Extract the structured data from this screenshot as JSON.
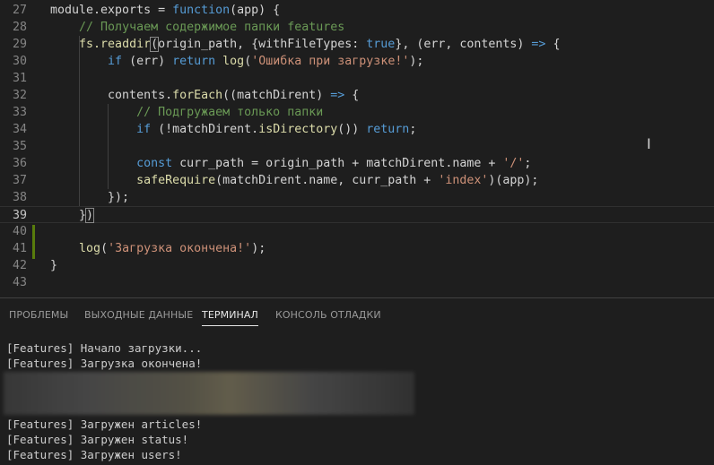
{
  "editor": {
    "lines": [
      {
        "num": "27",
        "tokens": [
          [
            "pl",
            "module.exports = "
          ],
          [
            "kw",
            "function"
          ],
          [
            "pl",
            "(app) {"
          ]
        ]
      },
      {
        "num": "28",
        "tokens": [
          [
            "pl",
            "    "
          ],
          [
            "cmt",
            "// Получаем содержимое папки features"
          ]
        ]
      },
      {
        "num": "29",
        "tokens": [
          [
            "pl",
            "    "
          ],
          [
            "fn",
            "fs.readdir"
          ],
          [
            "br",
            "("
          ],
          [
            "pl",
            "origin_path, {withFileTypes: "
          ],
          [
            "kw",
            "true"
          ],
          [
            "pl",
            "}, (err, contents) "
          ],
          [
            "kw",
            "=>"
          ],
          [
            "pl",
            " {"
          ]
        ]
      },
      {
        "num": "30",
        "tokens": [
          [
            "pl",
            "        "
          ],
          [
            "kw",
            "if"
          ],
          [
            "pl",
            " (err) "
          ],
          [
            "kw",
            "return"
          ],
          [
            "pl",
            " "
          ],
          [
            "fn",
            "log"
          ],
          [
            "pl",
            "("
          ],
          [
            "str",
            "'Ошибка при загрузке!'"
          ],
          [
            "pl",
            ");"
          ]
        ]
      },
      {
        "num": "31",
        "tokens": []
      },
      {
        "num": "32",
        "tokens": [
          [
            "pl",
            "        contents."
          ],
          [
            "fn",
            "forEach"
          ],
          [
            "pl",
            "((matchDirent) "
          ],
          [
            "kw",
            "=>"
          ],
          [
            "pl",
            " {"
          ]
        ]
      },
      {
        "num": "33",
        "tokens": [
          [
            "pl",
            "            "
          ],
          [
            "cmt",
            "// Подгружаем только папки"
          ]
        ]
      },
      {
        "num": "34",
        "tokens": [
          [
            "pl",
            "            "
          ],
          [
            "kw",
            "if"
          ],
          [
            "pl",
            " (!matchDirent."
          ],
          [
            "fn",
            "isDirectory"
          ],
          [
            "pl",
            "()) "
          ],
          [
            "kw",
            "return"
          ],
          [
            "pl",
            ";"
          ]
        ]
      },
      {
        "num": "35",
        "tokens": []
      },
      {
        "num": "36",
        "tokens": [
          [
            "pl",
            "            "
          ],
          [
            "kw",
            "const"
          ],
          [
            "pl",
            " curr_path = origin_path + matchDirent.name + "
          ],
          [
            "str",
            "'/'"
          ],
          [
            "pl",
            ";"
          ]
        ]
      },
      {
        "num": "37",
        "tokens": [
          [
            "pl",
            "            "
          ],
          [
            "fn",
            "safeRequire"
          ],
          [
            "pl",
            "(matchDirent.name, curr_path + "
          ],
          [
            "str",
            "'index'"
          ],
          [
            "pl",
            ")(app);"
          ]
        ]
      },
      {
        "num": "38",
        "tokens": [
          [
            "pl",
            "        });"
          ]
        ]
      },
      {
        "num": "39",
        "tokens": [
          [
            "pl",
            "    }"
          ],
          [
            "br",
            ")"
          ]
        ]
      },
      {
        "num": "40",
        "tokens": []
      },
      {
        "num": "41",
        "tokens": [
          [
            "pl",
            "    "
          ],
          [
            "fn",
            "log"
          ],
          [
            "pl",
            "("
          ],
          [
            "str",
            "'Загрузка окончена!'"
          ],
          [
            "pl",
            ");"
          ]
        ]
      },
      {
        "num": "42",
        "tokens": [
          [
            "pl",
            "}"
          ]
        ]
      },
      {
        "num": "43",
        "tokens": []
      }
    ],
    "current_line": "39"
  },
  "panel": {
    "tabs": [
      "ПРОБЛЕМЫ",
      "ВЫХОДНЫЕ ДАННЫЕ",
      "ТЕРМИНАЛ",
      "КОНСОЛЬ ОТЛАДКИ"
    ],
    "active_tab": "ТЕРМИНАЛ"
  },
  "terminal": {
    "lines_top": [
      "[Features] Начало загрузки...",
      "[Features] Загрузка окончена!"
    ],
    "lines_bottom": [
      "[Features] Загружен articles!",
      "[Features] Загружен status!",
      "[Features] Загружен users!"
    ]
  },
  "colors": {
    "background": "#1e1e1e",
    "keyword": "#569cd6",
    "function": "#dcdcaa",
    "string": "#ce9178",
    "comment": "#6a9955",
    "gutter_modified": "#587c0c"
  },
  "icons": {
    "text_cursor": "i-beam-cursor-icon"
  }
}
